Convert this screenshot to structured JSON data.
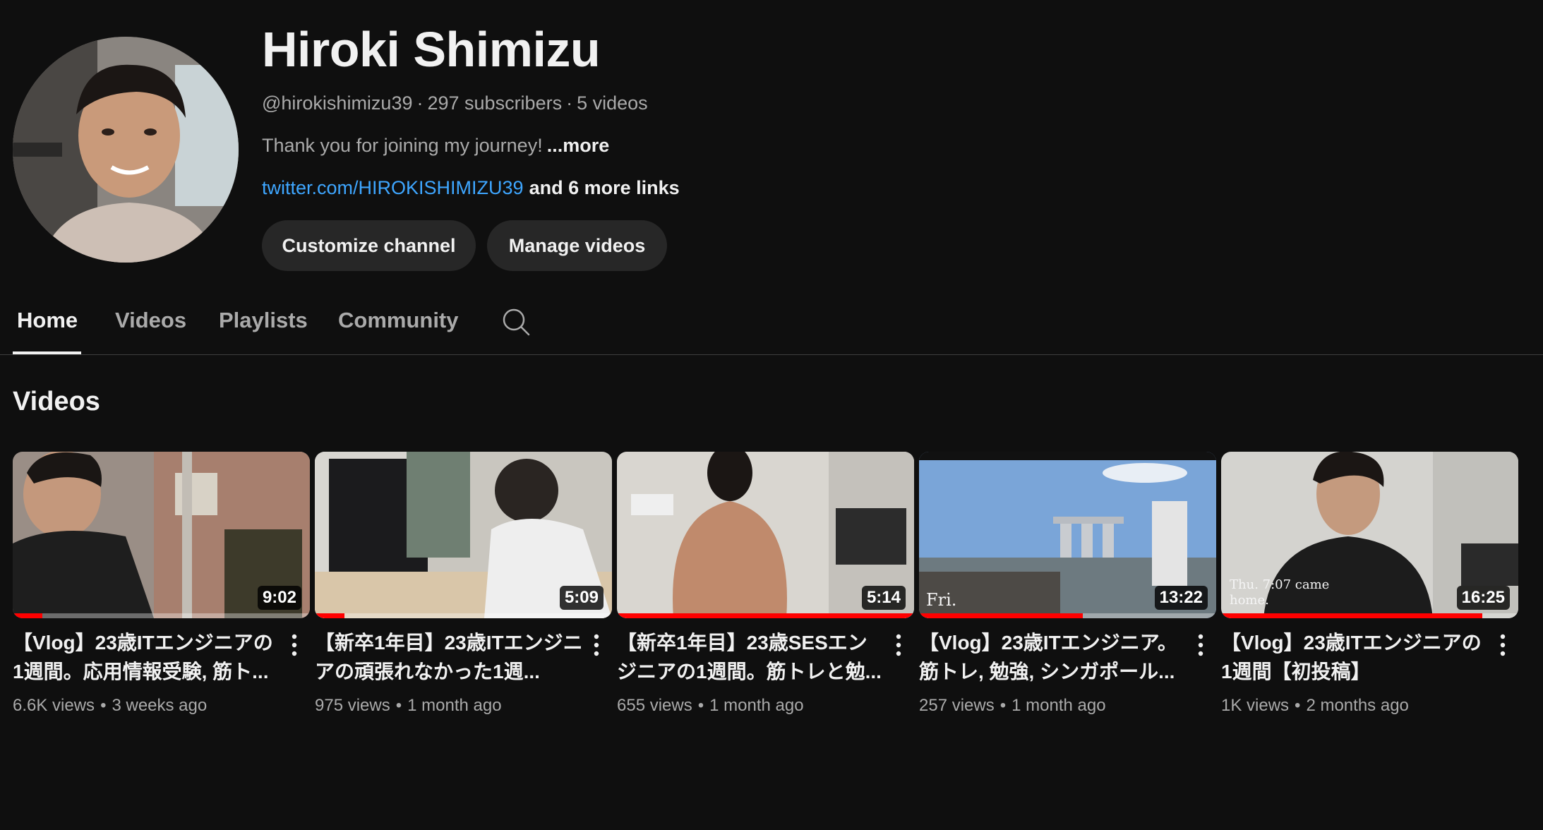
{
  "channel": {
    "name": "Hiroki Shimizu",
    "handle": "@hirokishimizu39",
    "subscribers": "297 subscribers",
    "video_count": "5 videos",
    "meta_separator": "·",
    "description": "Thank you for joining my journey!",
    "more_label": "...more",
    "link_text": "twitter.com/HIROKISHIMIZU39",
    "more_links_label": "and 6 more links"
  },
  "actions": {
    "customize_label": "Customize channel",
    "manage_label": "Manage videos"
  },
  "tabs": [
    {
      "label": "Home",
      "active": true
    },
    {
      "label": "Videos",
      "active": false
    },
    {
      "label": "Playlists",
      "active": false
    },
    {
      "label": "Community",
      "active": false
    }
  ],
  "section": {
    "title": "Videos"
  },
  "videos": [
    {
      "title": "【Vlog】23歳ITエンジニアの1週間。応用情報受験, 筋ト...",
      "duration": "9:02",
      "views": "6.6K views",
      "age": "3 weeks ago",
      "progress_fraction": 0.1,
      "thumb_text": ""
    },
    {
      "title": "【新卒1年目】23歳ITエンジニアの頑張れなかった1週...",
      "duration": "5:09",
      "views": "975 views",
      "age": "1 month ago",
      "progress_fraction": 0.1,
      "thumb_text": ""
    },
    {
      "title": "【新卒1年目】23歳SESエンジニアの1週間。筋トレと勉...",
      "duration": "5:14",
      "views": "655 views",
      "age": "1 month ago",
      "progress_fraction": 1.0,
      "thumb_text": ""
    },
    {
      "title": "【Vlog】23歳ITエンジニア。筋トレ, 勉強, シンガポール...",
      "duration": "13:22",
      "views": "257 views",
      "age": "1 month ago",
      "progress_fraction": 0.55,
      "thumb_text": "Fri."
    },
    {
      "title": "【Vlog】23歳ITエンジニアの1週間【初投稿】",
      "duration": "16:25",
      "views": "1K views",
      "age": "2 months ago",
      "progress_fraction": 0.88,
      "thumb_text": "Thu. 7:07 came home."
    }
  ],
  "colors": {
    "background": "#0f0f0f",
    "button_bg": "#272727",
    "link": "#3ea6ff",
    "progress": "#ff0000",
    "secondary_text": "#aaaaaa"
  },
  "icons": {
    "search": "search-icon",
    "kebab": "more-vert-icon"
  }
}
